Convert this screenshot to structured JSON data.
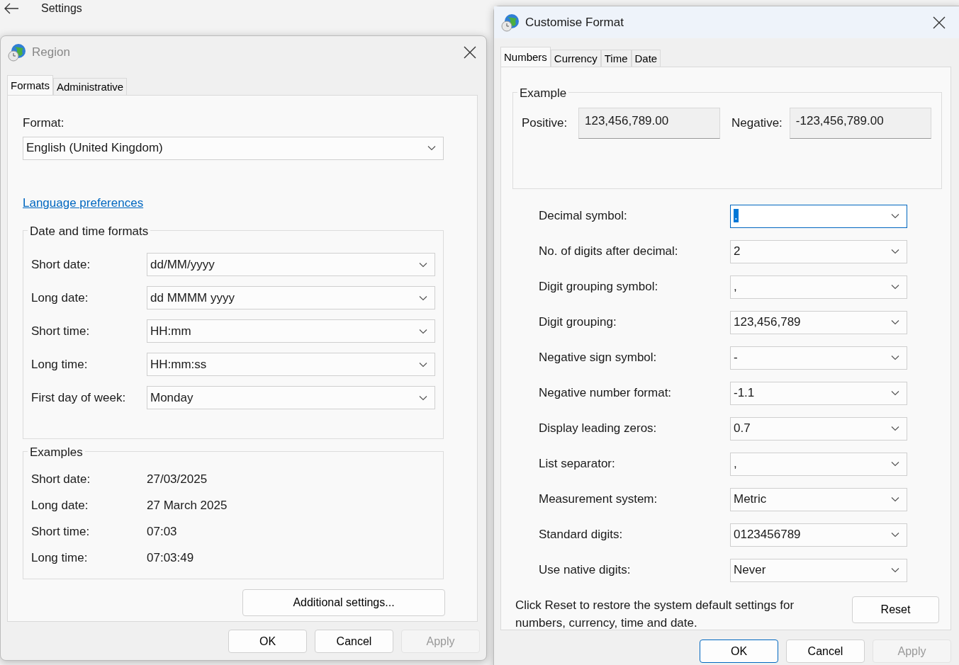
{
  "background": {
    "title": "Settings"
  },
  "region": {
    "title": "Region",
    "tabs": [
      {
        "label": "Formats",
        "selected": true
      },
      {
        "label": "Administrative",
        "selected": false
      }
    ],
    "format_label": "Format:",
    "format_value": "English (United Kingdom)",
    "link": "Language preferences",
    "datetime_group": {
      "title": "Date and time formats",
      "rows": [
        {
          "label": "Short date:",
          "value": "dd/MM/yyyy"
        },
        {
          "label": "Long date:",
          "value": "dd MMMM yyyy"
        },
        {
          "label": "Short time:",
          "value": "HH:mm"
        },
        {
          "label": "Long time:",
          "value": "HH:mm:ss"
        },
        {
          "label": "First day of week:",
          "value": "Monday"
        }
      ]
    },
    "examples": {
      "title": "Examples",
      "rows": [
        {
          "label": "Short date:",
          "value": "27/03/2025"
        },
        {
          "label": "Long date:",
          "value": "27 March 2025"
        },
        {
          "label": "Short time:",
          "value": "07:03"
        },
        {
          "label": "Long time:",
          "value": "07:03:49"
        }
      ]
    },
    "additional_button": "Additional settings...",
    "buttons": [
      {
        "label": "OK",
        "disabled": false,
        "default": false
      },
      {
        "label": "Cancel",
        "disabled": false,
        "default": false
      },
      {
        "label": "Apply",
        "disabled": true,
        "default": false
      }
    ]
  },
  "customise": {
    "title": "Customise Format",
    "tabs": [
      {
        "label": "Numbers",
        "selected": true
      },
      {
        "label": "Currency",
        "selected": false
      },
      {
        "label": "Time",
        "selected": false
      },
      {
        "label": "Date",
        "selected": false
      }
    ],
    "example": {
      "title": "Example",
      "positive_label": "Positive:",
      "positive": "123,456,789.00",
      "negative_label": "Negative:",
      "negative": "-123,456,789.00"
    },
    "settings": [
      {
        "label": "Decimal symbol:",
        "value": ".",
        "focused": true
      },
      {
        "label": "No. of digits after decimal:",
        "value": "2",
        "focused": false
      },
      {
        "label": "Digit grouping symbol:",
        "value": ",",
        "focused": false
      },
      {
        "label": "Digit grouping:",
        "value": "123,456,789",
        "focused": false
      },
      {
        "label": "Negative sign symbol:",
        "value": "-",
        "focused": false
      },
      {
        "label": "Negative number format:",
        "value": "-1.1",
        "focused": false
      },
      {
        "label": "Display leading zeros:",
        "value": "0.7",
        "focused": false
      },
      {
        "label": "List separator:",
        "value": ",",
        "focused": false
      },
      {
        "label": "Measurement system:",
        "value": "Metric",
        "focused": false
      },
      {
        "label": "Standard digits:",
        "value": "0123456789",
        "focused": false
      },
      {
        "label": "Use native digits:",
        "value": "Never",
        "focused": false
      }
    ],
    "reset_note": "Click Reset to restore the system default settings for numbers, currency, time and date.",
    "reset_button": "Reset",
    "buttons": [
      {
        "label": "OK",
        "disabled": false,
        "default": true
      },
      {
        "label": "Cancel",
        "disabled": false,
        "default": false
      },
      {
        "label": "Apply",
        "disabled": true,
        "default": false
      }
    ]
  }
}
